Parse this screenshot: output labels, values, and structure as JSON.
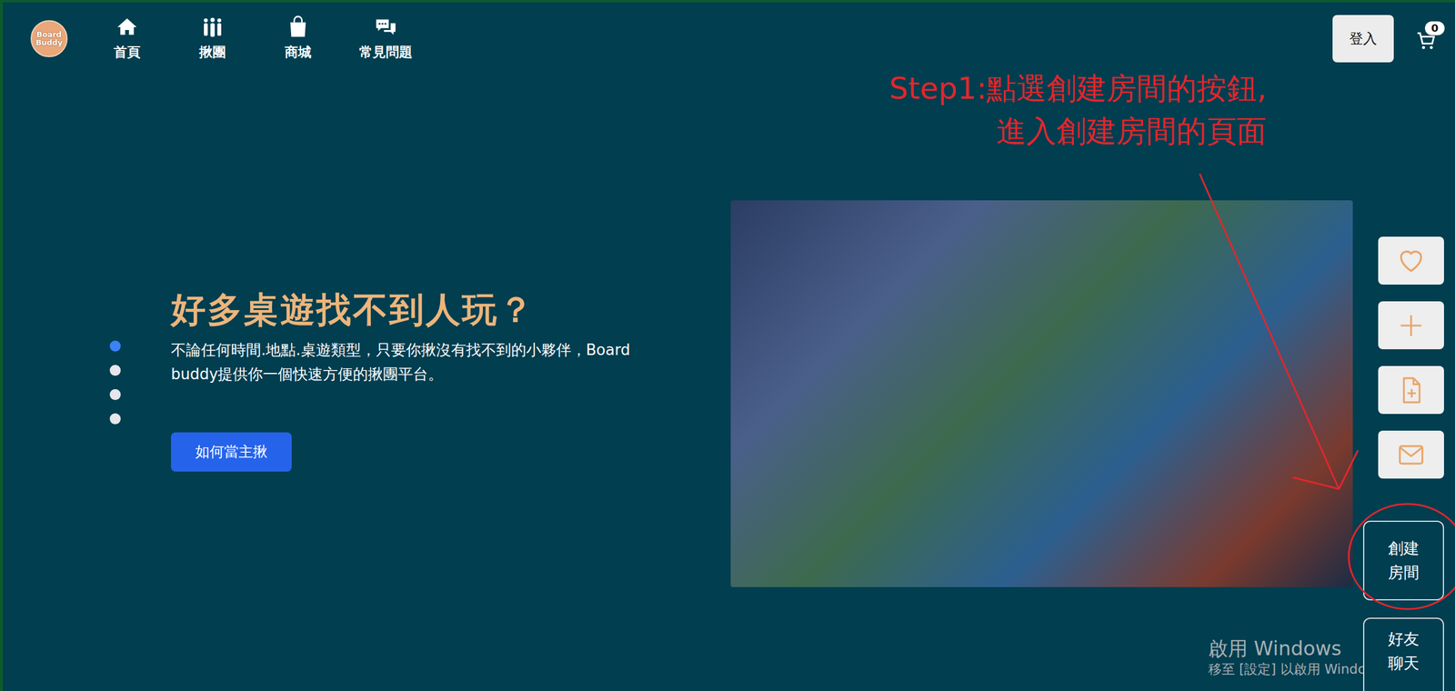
{
  "logo": {
    "text": "Board Buddy"
  },
  "nav": [
    {
      "label": "首頁"
    },
    {
      "label": "揪團"
    },
    {
      "label": "商城"
    },
    {
      "label": "常見問題"
    }
  ],
  "login": {
    "label": "登入"
  },
  "cart": {
    "count": "0"
  },
  "annotation": {
    "lines": [
      "Step1:點選創建房間的按鈕,",
      "進入創建房間的頁面"
    ]
  },
  "hero": {
    "title": "好多桌遊找不到人玩？",
    "description": "不論任何時間.地點.桌遊類型，只要你揪沒有找不到的小夥伴，Board buddy提供你一個快速方便的揪團平台。",
    "button": "如何當主揪"
  },
  "carousel": {
    "dots": [
      {
        "selected": true
      },
      {
        "selected": false
      },
      {
        "selected": false
      },
      {
        "selected": false
      }
    ]
  },
  "sidebar": {
    "text_buttons": [
      {
        "label": "創建房間"
      },
      {
        "label": "好友聊天"
      }
    ]
  },
  "watermark": {
    "title": "啟用 Windows",
    "subtitle": "移至 [設定] 以啟用 Windo"
  }
}
